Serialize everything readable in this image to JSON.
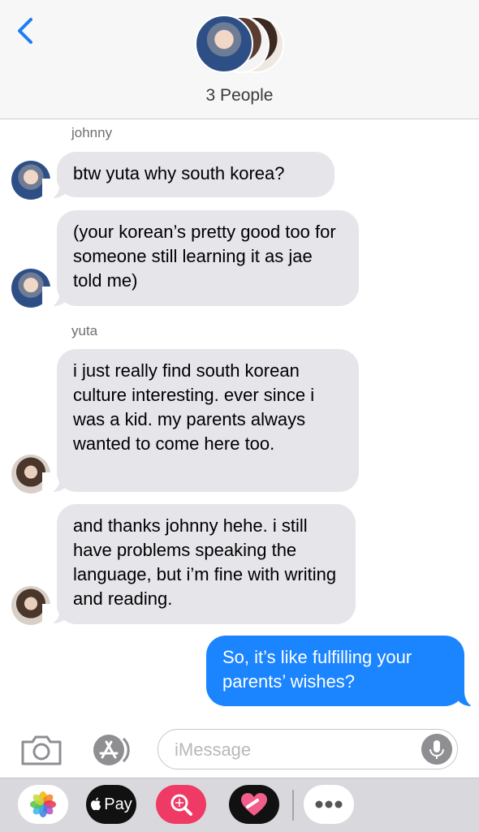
{
  "header": {
    "back_icon": "chevron-left-icon",
    "title": "3 People"
  },
  "messages": [
    {
      "sender": "johnny",
      "text": "btw yuta why south korea?"
    },
    {
      "text": "(your korean’s pretty good too for someone still learning it as jae told me)"
    },
    {
      "sender": "yuta",
      "text": "i just really find south korean culture interesting. ever since i was a kid. my parents always wanted to come here too."
    },
    {
      "text": "and thanks johnny hehe. i still have problems speaking the language, but i’m fine with writing and reading."
    },
    {
      "text": "So, it’s like fulfilling your parents’ wishes?"
    }
  ],
  "input": {
    "placeholder": "iMessage",
    "camera_icon": "camera-icon",
    "app_store_icon": "app-store-icon",
    "mic_icon": "microphone-icon"
  },
  "drawer": {
    "pay_label": "Pay",
    "apps": [
      "photos-icon",
      "apple-pay-icon",
      "image-search-icon",
      "heart-icon",
      "more-icon"
    ]
  },
  "colors": {
    "sent_bubble": "#1b84ff",
    "received_bubble": "#e5e5ea",
    "header_bg": "#f7f7f7"
  }
}
